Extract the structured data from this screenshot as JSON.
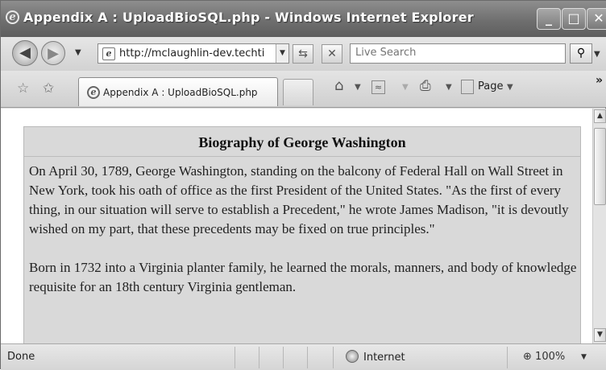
{
  "window": {
    "title": "Appendix A : UploadBioSQL.php - Windows Internet Explorer",
    "controls": {
      "minimize": "_",
      "maximize": "□",
      "close": "✕"
    }
  },
  "address_bar": {
    "url": "http://mclaughlin-dev.techti",
    "search_placeholder": "Live Search"
  },
  "tab": {
    "label": "Appendix A : UploadBioSQL.php"
  },
  "command_bar": {
    "page_label": "Page"
  },
  "content": {
    "heading": "Biography of George Washington",
    "paragraphs": [
      "On April 30, 1789, George Washington, standing on the balcony of Federal Hall on Wall Street in New York, took his oath of office as the first President of the United States. \"As the first of every thing, in our situation will serve to establish a Precedent,\" he wrote James Madison, \"it is devoutly wished on my part, that these precedents may be fixed on true principles.\"",
      "Born in 1732 into a Virginia planter family, he learned the morals, manners, and body of knowledge requisite for an 18th century Virginia gentleman."
    ]
  },
  "status_bar": {
    "status": "Done",
    "zone": "Internet",
    "zoom": "100%"
  },
  "icons": {
    "ie": "ie-logo-icon",
    "back": "back-arrow-icon",
    "forward": "forward-arrow-icon",
    "refresh": "refresh-icon",
    "stop": "stop-icon",
    "search": "magnifier-icon",
    "favorites": "favorites-star-icon",
    "add_favorites": "add-favorites-icon",
    "home": "home-icon",
    "feeds": "feeds-icon",
    "print": "print-icon",
    "page": "page-icon",
    "globe": "globe-icon",
    "zoom": "zoom-icon"
  }
}
